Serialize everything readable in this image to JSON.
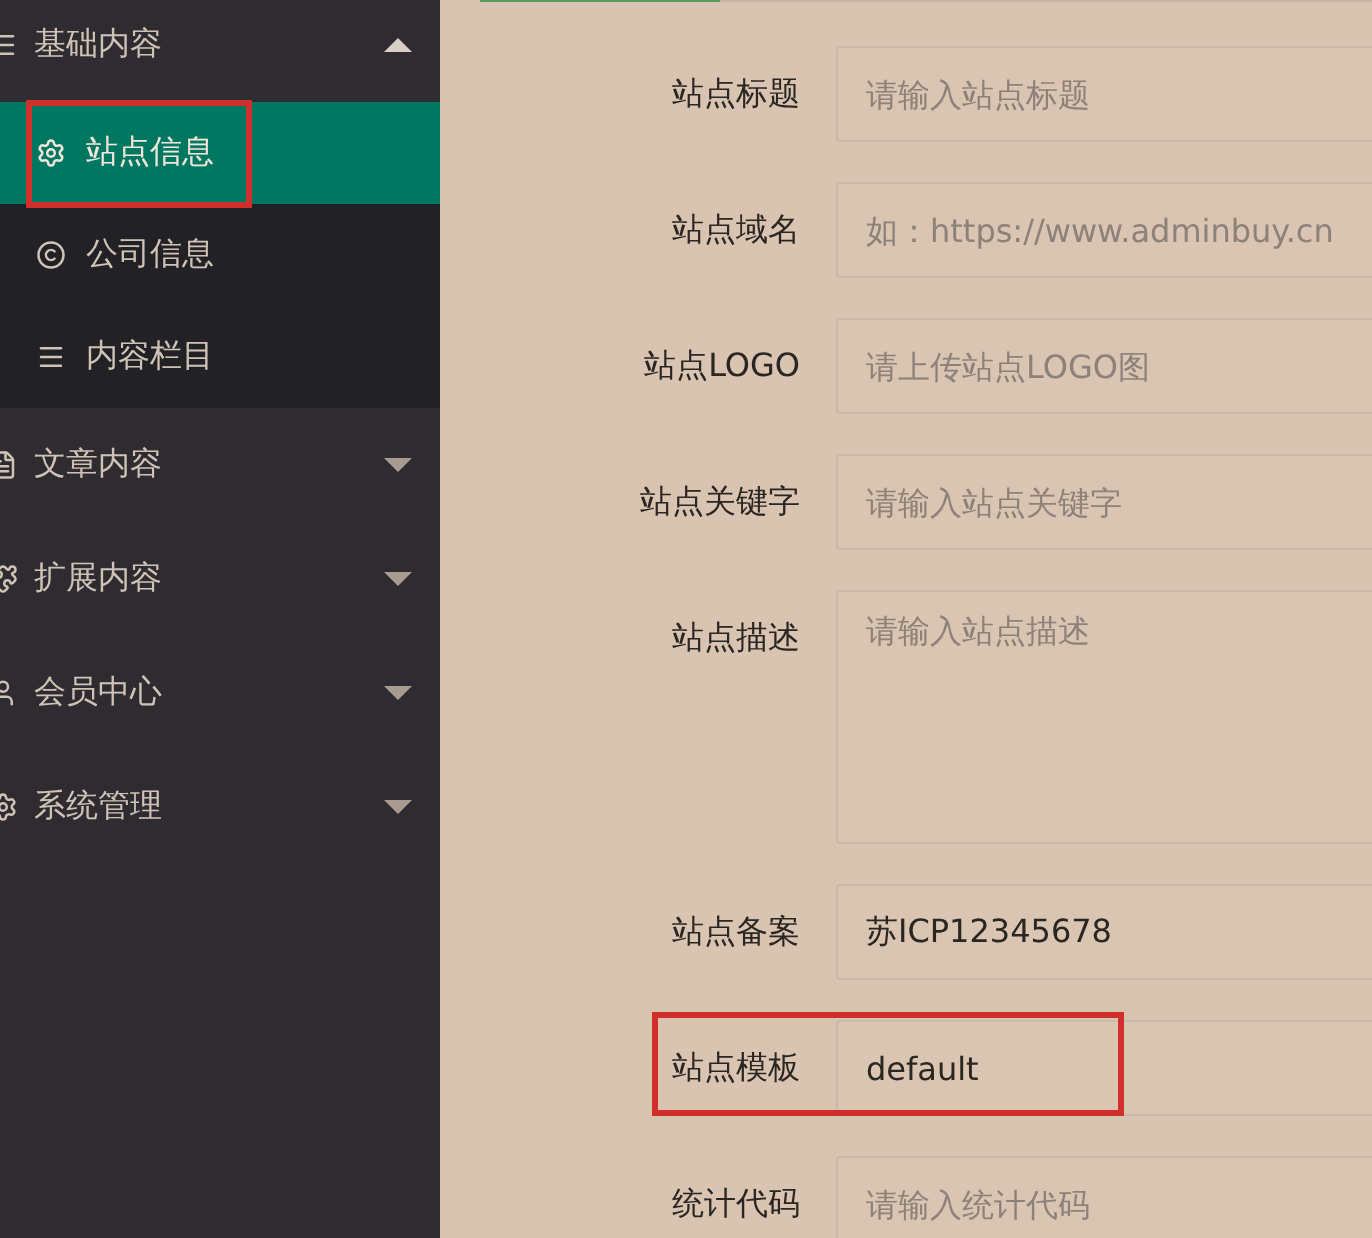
{
  "sidebar": {
    "groups": [
      {
        "label": "基础内容",
        "expanded": true,
        "children": [
          {
            "label": "站点信息",
            "selected": true,
            "highlighted": true
          },
          {
            "label": "公司信息",
            "selected": false,
            "highlighted": false
          },
          {
            "label": "内容栏目",
            "selected": false,
            "highlighted": false
          }
        ]
      },
      {
        "label": "文章内容",
        "expanded": false
      },
      {
        "label": "扩展内容",
        "expanded": false
      },
      {
        "label": "会员中心",
        "expanded": false
      },
      {
        "label": "系统管理",
        "expanded": false
      }
    ]
  },
  "form": {
    "fields": [
      {
        "label": "站点标题",
        "kind": "input",
        "placeholder": "请输入站点标题",
        "highlighted": false
      },
      {
        "label": "站点域名",
        "kind": "input",
        "placeholder": "如：https://www.adminbuy.cn",
        "highlighted": false
      },
      {
        "label": "站点LOGO",
        "kind": "input",
        "placeholder": "请上传站点LOGO图",
        "highlighted": false
      },
      {
        "label": "站点关键字",
        "kind": "input",
        "placeholder": "请输入站点关键字",
        "highlighted": false
      },
      {
        "label": "站点描述",
        "kind": "textarea",
        "placeholder": "请输入站点描述",
        "highlighted": false
      },
      {
        "label": "站点备案",
        "kind": "input",
        "value": "苏ICP12345678",
        "highlighted": false
      },
      {
        "label": "站点模板",
        "kind": "input",
        "value": "default",
        "highlighted": true
      },
      {
        "label": "统计代码",
        "kind": "input",
        "placeholder": "请输入统计代码",
        "highlighted": false
      }
    ]
  }
}
